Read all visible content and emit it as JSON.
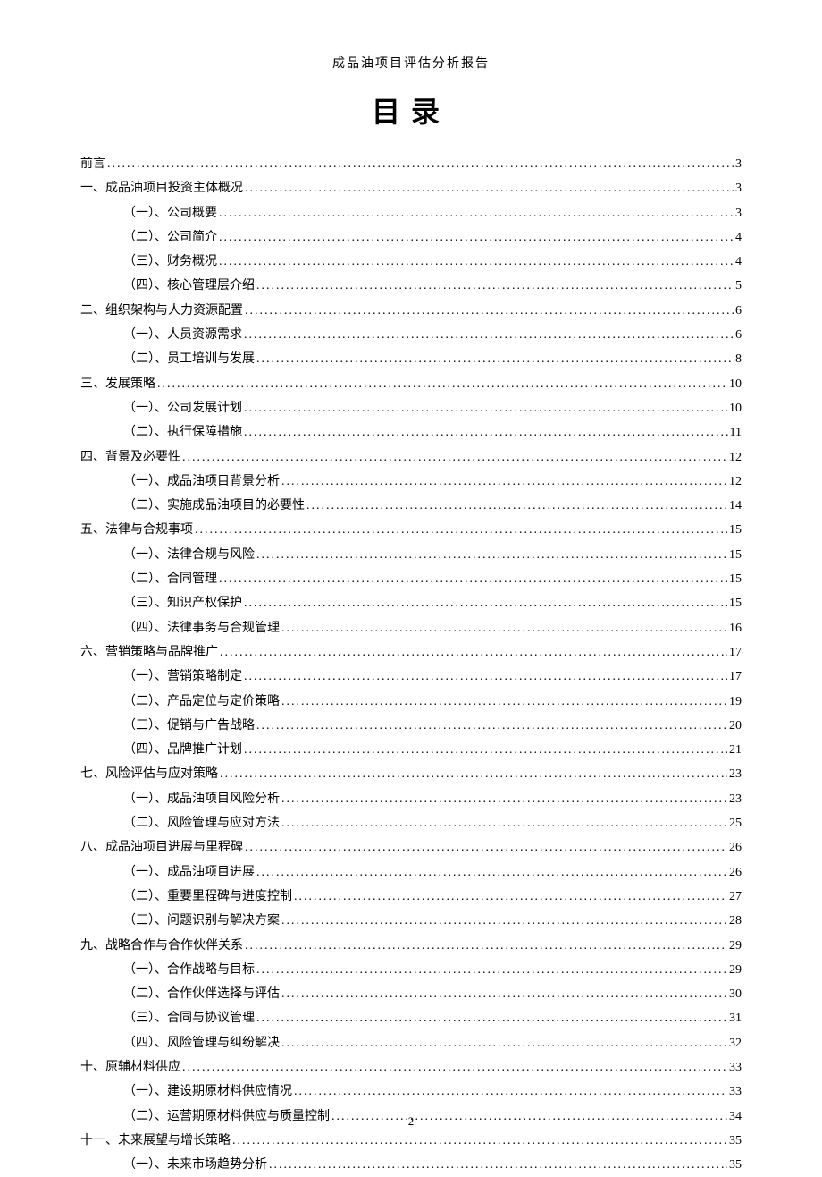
{
  "header": "成品油项目评估分析报告",
  "title": "目录",
  "pageNumber": "2",
  "toc": [
    {
      "level": 1,
      "label": "前言",
      "page": "3"
    },
    {
      "level": 1,
      "label": "一、成品油项目投资主体概况",
      "page": "3"
    },
    {
      "level": 2,
      "label": "（一）、公司概要",
      "page": "3"
    },
    {
      "level": 2,
      "label": "（二）、公司简介",
      "page": "4"
    },
    {
      "level": 2,
      "label": "（三）、财务概况",
      "page": "4"
    },
    {
      "level": 2,
      "label": "（四）、核心管理层介绍",
      "page": "5"
    },
    {
      "level": 1,
      "label": "二、组织架构与人力资源配置",
      "page": "6"
    },
    {
      "level": 2,
      "label": "（一）、人员资源需求",
      "page": "6"
    },
    {
      "level": 2,
      "label": "（二）、员工培训与发展",
      "page": "8"
    },
    {
      "level": 1,
      "label": "三、发展策略 ",
      "page": "10"
    },
    {
      "level": 2,
      "label": "（一）、公司发展计划",
      "page": "10"
    },
    {
      "level": 2,
      "label": "（二）、执行保障措施",
      "page": "11"
    },
    {
      "level": 1,
      "label": "四、背景及必要性 ",
      "page": "12"
    },
    {
      "level": 2,
      "label": "（一）、成品油项目背景分析",
      "page": "12"
    },
    {
      "level": 2,
      "label": "（二）、实施成品油项目的必要性",
      "page": "14"
    },
    {
      "level": 1,
      "label": "五、法律与合规事项 ",
      "page": "15"
    },
    {
      "level": 2,
      "label": "（一）、法律合规与风险",
      "page": "15"
    },
    {
      "level": 2,
      "label": "（二）、合同管理 ",
      "page": "15"
    },
    {
      "level": 2,
      "label": "（三）、知识产权保护",
      "page": "15"
    },
    {
      "level": 2,
      "label": "（四）、法律事务与合规管理",
      "page": "16"
    },
    {
      "level": 1,
      "label": "六、营销策略与品牌推广",
      "page": "17"
    },
    {
      "level": 2,
      "label": "（一）、营销策略制定",
      "page": "17"
    },
    {
      "level": 2,
      "label": "（二）、产品定位与定价策略",
      "page": "19"
    },
    {
      "level": 2,
      "label": "（三）、促销与广告战略",
      "page": "20"
    },
    {
      "level": 2,
      "label": "（四）、品牌推广计划",
      "page": "21"
    },
    {
      "level": 1,
      "label": "七、风险评估与应对策略",
      "page": "23"
    },
    {
      "level": 2,
      "label": "（一）、成品油项目风险分析",
      "page": "23"
    },
    {
      "level": 2,
      "label": "（二）、风险管理与应对方法",
      "page": "25"
    },
    {
      "level": 1,
      "label": "八、成品油项目进展与里程碑",
      "page": "26"
    },
    {
      "level": 2,
      "label": "（一）、成品油项目进展",
      "page": "26"
    },
    {
      "level": 2,
      "label": "（二）、重要里程碑与进度控制",
      "page": "27"
    },
    {
      "level": 2,
      "label": "（三）、问题识别与解决方案",
      "page": "28"
    },
    {
      "level": 1,
      "label": "九、战略合作与合作伙伴关系",
      "page": "29"
    },
    {
      "level": 2,
      "label": "（一）、合作战略与目标",
      "page": "29"
    },
    {
      "level": 2,
      "label": "（二）、合作伙伴选择与评估",
      "page": "30"
    },
    {
      "level": 2,
      "label": "（三）、合同与协议管理",
      "page": "31"
    },
    {
      "level": 2,
      "label": "（四）、风险管理与纠纷解决",
      "page": "32"
    },
    {
      "level": 1,
      "label": "十、原辅材料供应 ",
      "page": "33"
    },
    {
      "level": 2,
      "label": "（一）、建设期原材料供应情况",
      "page": "33"
    },
    {
      "level": 2,
      "label": "（二）、运营期原材料供应与质量控制",
      "page": "34"
    },
    {
      "level": 1,
      "label": "十一、未来展望与增长策略",
      "page": "35"
    },
    {
      "level": 2,
      "label": "（一）、未来市场趋势分析",
      "page": "35"
    }
  ]
}
